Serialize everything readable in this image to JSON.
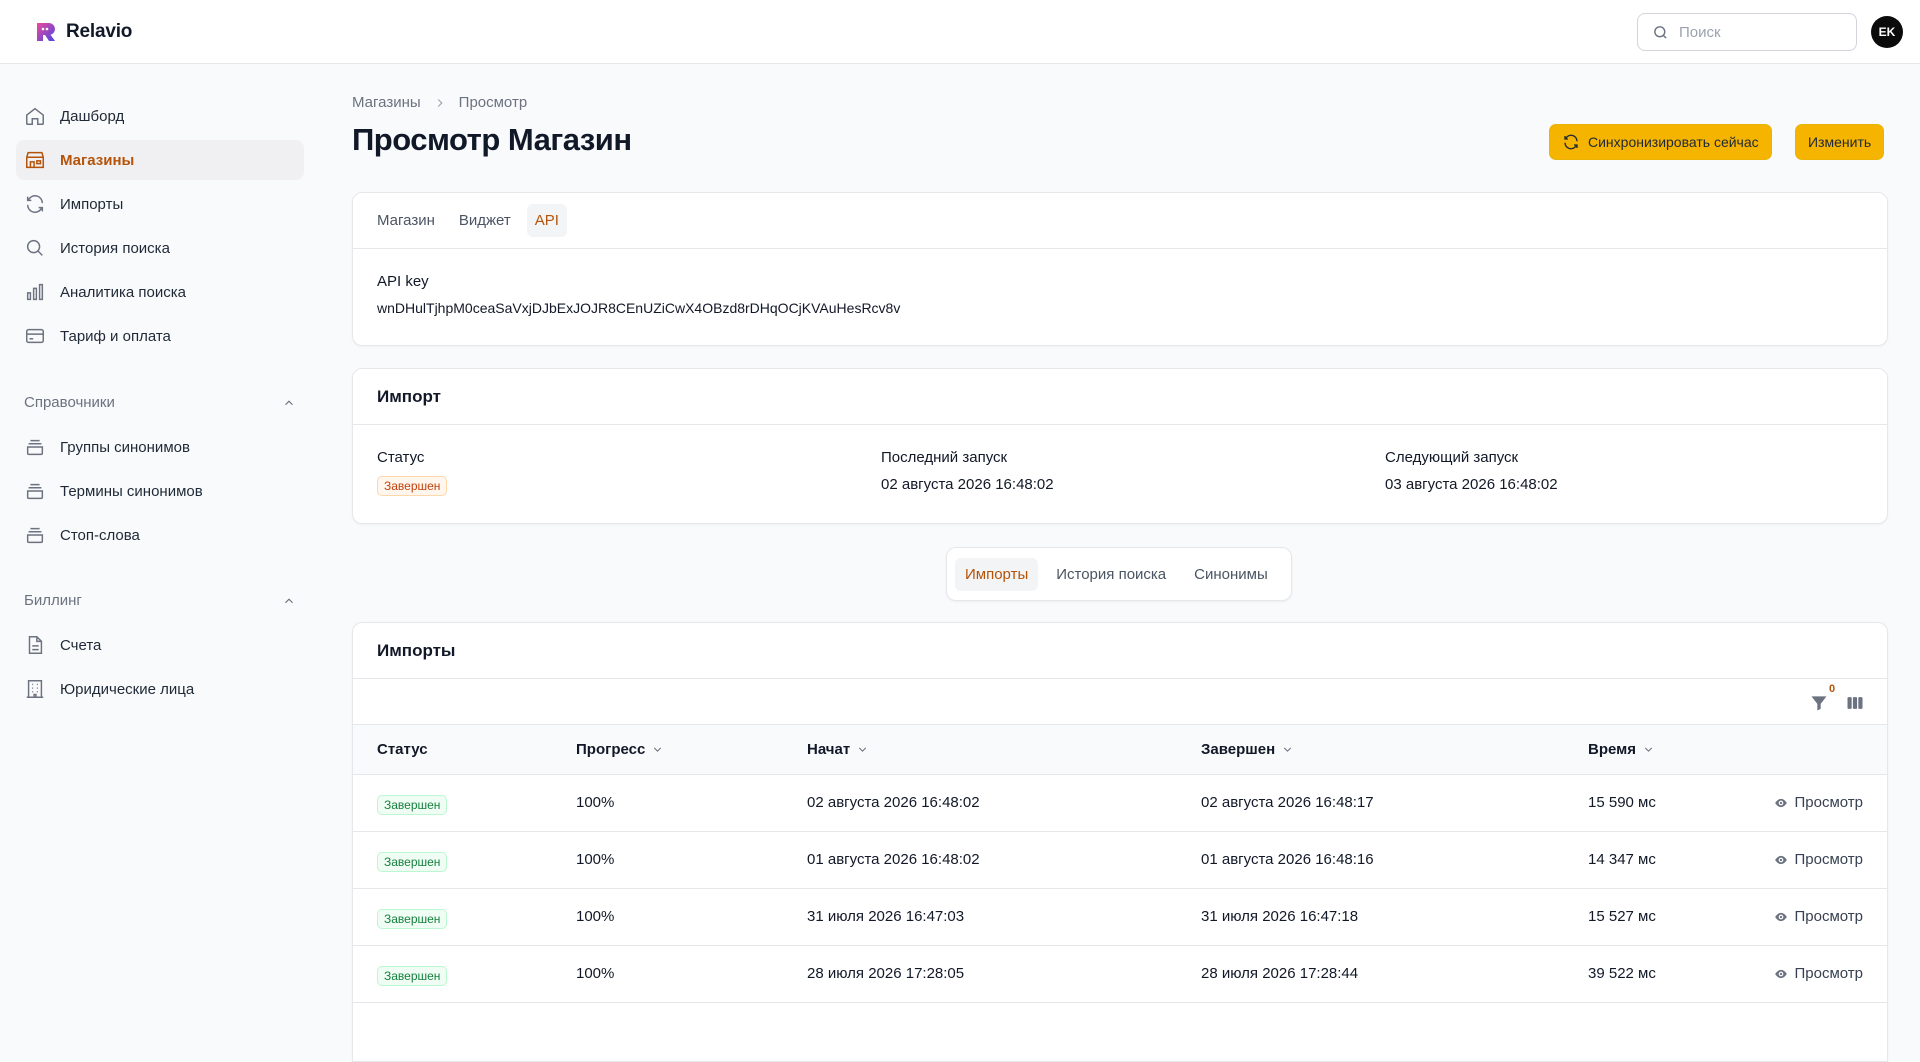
{
  "app": {
    "name": "Relavio"
  },
  "search": {
    "placeholder": "Поиск"
  },
  "user": {
    "initials": "EK"
  },
  "sidebar": {
    "items": [
      {
        "label": "Дашборд",
        "icon": "home-icon"
      },
      {
        "label": "Магазины",
        "icon": "store-icon",
        "active": true
      },
      {
        "label": "Импорты",
        "icon": "refresh-icon"
      },
      {
        "label": "История поиска",
        "icon": "search-icon"
      },
      {
        "label": "Аналитика поиска",
        "icon": "bar-chart-icon"
      },
      {
        "label": "Тариф и оплата",
        "icon": "credit-card-icon"
      }
    ],
    "groups": [
      {
        "label": "Справочники",
        "items": [
          {
            "label": "Группы синонимов",
            "icon": "stack-icon"
          },
          {
            "label": "Термины синонимов",
            "icon": "stack-icon"
          },
          {
            "label": "Стоп-слова",
            "icon": "stack-icon"
          }
        ]
      },
      {
        "label": "Биллинг",
        "items": [
          {
            "label": "Счета",
            "icon": "document-icon"
          },
          {
            "label": "Юридические лица",
            "icon": "building-icon"
          }
        ]
      }
    ]
  },
  "breadcrumb": {
    "parent": "Магазины",
    "current": "Просмотр"
  },
  "page": {
    "title": "Просмотр Магазин"
  },
  "actions": {
    "sync_label": "Синхронизировать сейчас",
    "edit_label": "Изменить"
  },
  "store_tabs": [
    "Магазин",
    "Виджет",
    "API"
  ],
  "api": {
    "label": "API key",
    "value": "wnDHulTjhpM0ceaSaVxjDJbExJOJR8CEnUZiCwX4OBzd8rDHqOCjKVAuHesRcv8v"
  },
  "import_section": {
    "title": "Импорт",
    "status_label": "Статус",
    "status_value": "Завершен",
    "last_run_label": "Последний запуск",
    "last_run_value": "02 августа 2026 16:48:02",
    "next_run_label": "Следующий запуск",
    "next_run_value": "03 августа 2026 16:48:02"
  },
  "relation_tabs": [
    "Импорты",
    "История поиска",
    "Синонимы"
  ],
  "imports_table": {
    "title": "Импорты",
    "filter_count": "0",
    "columns": [
      "Статус",
      "Прогресс",
      "Начат",
      "Завершен",
      "Время"
    ],
    "view_label": "Просмотр",
    "rows": [
      {
        "status": "Завершен",
        "progress": "100%",
        "started": "02 августа 2026 16:48:02",
        "finished": "02 августа 2026 16:48:17",
        "duration": "15 590 мс"
      },
      {
        "status": "Завершен",
        "progress": "100%",
        "started": "01 августа 2026 16:48:02",
        "finished": "01 августа 2026 16:48:16",
        "duration": "14 347 мс"
      },
      {
        "status": "Завершен",
        "progress": "100%",
        "started": "31 июля 2026 16:47:03",
        "finished": "31 июля 2026 16:47:18",
        "duration": "15 527 мс"
      },
      {
        "status": "Завершен",
        "progress": "100%",
        "started": "28 июля 2026 17:28:05",
        "finished": "28 июля 2026 17:28:44",
        "duration": "39 522 мс"
      }
    ]
  },
  "colors": {
    "accent": "#f5b400",
    "active_text": "#b45309"
  }
}
